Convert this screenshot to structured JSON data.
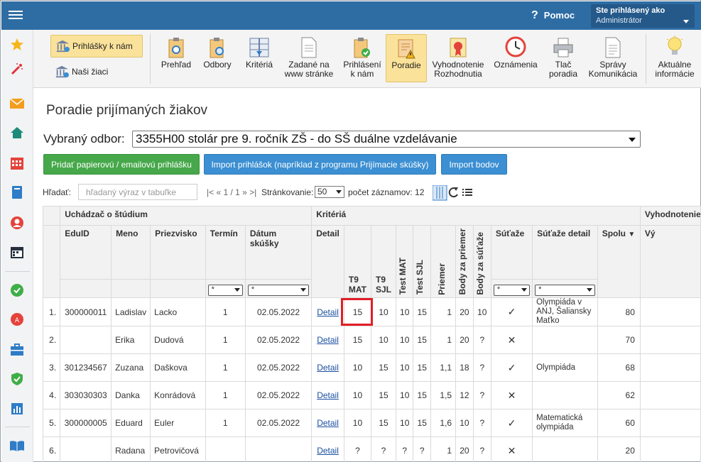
{
  "header": {
    "help_label": "Pomoc",
    "login_title": "Ste prihlásený ako",
    "login_user": "Administrátor"
  },
  "sidebar_icons": [
    "star-icon",
    "magic-wand-icon",
    "envelope-icon",
    "home-icon",
    "calendar-grid-icon",
    "book-icon",
    "person-icon",
    "calendar-icon",
    "check-circle-icon",
    "pdf-icon",
    "briefcase-icon",
    "shield-icon",
    "bar-chart-icon",
    "open-book-icon"
  ],
  "toolbar": {
    "left_buttons": [
      {
        "label": "Prihlášky k nám",
        "active": true
      },
      {
        "label": "Naši žiaci",
        "active": false
      }
    ],
    "buttons": [
      {
        "label": "Prehľad",
        "active": false
      },
      {
        "label": "Odbory",
        "active": false
      },
      {
        "label": "Kritériá",
        "active": false
      },
      {
        "label": "Zadané na\nwww stránke",
        "active": false
      },
      {
        "label": "Prihlásení\nk nám",
        "active": false
      },
      {
        "label": "Poradie",
        "active": true
      },
      {
        "label": "Vyhodnotenie\nRozhodnutia",
        "active": false
      },
      {
        "label": "Oznámenia",
        "active": false
      },
      {
        "label": "Tlač\nporadia",
        "active": false
      },
      {
        "label": "Správy\nKomunikácia",
        "active": false
      },
      {
        "label": "Aktuálne\ninformácie",
        "active": false
      }
    ]
  },
  "page": {
    "title": "Poradie prijímaných žiakov",
    "odbor_label": "Vybraný odbor:",
    "odbor_value": "3355H00 stolár pre 9. ročník ZŠ - do SŠ duálne vzdelávanie",
    "btn_add": "Pridať papierovú / emailovú prihlášku",
    "btn_import": "Import prihlášok (napríklad z programu Prijímacie skúšky)",
    "btn_import_points": "Import bodov",
    "search_label": "Hľadať:",
    "search_placeholder": "hľadaný výraz v tabuľke",
    "pager_text": "|< « 1 / 1 » >|",
    "paging_label": "Stránkovanie:",
    "paging_value": "50",
    "count_label": "počet záznamov: 12"
  },
  "table": {
    "group_headers": {
      "applicant": "Uchádzač o štúdium",
      "criteria": "Kritériá",
      "evaluation": "Vyhodnotenie"
    },
    "headers": {
      "eduid": "EduID",
      "meno": "Meno",
      "priezvisko": "Priezvisko",
      "termin": "Termín",
      "datum": "Dátum skúšky",
      "detail": "Detail",
      "t9mat": "T9\nMAT",
      "t9sjl": "T9\nSJL",
      "testmat": "Test MAT",
      "testsjl": "Test SJL",
      "priemer": "Priemer",
      "body_priemer": "Body za priemer",
      "body_sutaze": "Body za súťaže",
      "sutaze": "Súťaže",
      "sutaze_detail": "Súťaže detail",
      "spolu": "Spolu",
      "vy": "Vý"
    },
    "filter_value": "*",
    "rows": [
      {
        "no": "1.",
        "eduid": "300000011",
        "meno": "Ladislav",
        "priezvisko": "Lacko",
        "termin": "1",
        "datum": "02.05.2022",
        "detail": "Detail",
        "t9mat": "15",
        "t9sjl": "10",
        "testmat": "10",
        "testsjl": "15",
        "priemer": "1",
        "bp": "20",
        "bs": "10",
        "sutaze": "✓",
        "sdetail": "Olympiáda v ANJ, Šaliansky Maťko",
        "spolu": "80"
      },
      {
        "no": "2.",
        "eduid": "",
        "meno": "Erika",
        "priezvisko": "Dudová",
        "termin": "1",
        "datum": "02.05.2022",
        "detail": "Detail",
        "t9mat": "15",
        "t9sjl": "10",
        "testmat": "10",
        "testsjl": "15",
        "priemer": "1",
        "bp": "20",
        "bs": "?",
        "sutaze": "✕",
        "sdetail": "",
        "spolu": "70"
      },
      {
        "no": "3.",
        "eduid": "301234567",
        "meno": "Zuzana",
        "priezvisko": "Daškova",
        "termin": "1",
        "datum": "02.05.2022",
        "detail": "Detail",
        "t9mat": "10",
        "t9sjl": "15",
        "testmat": "10",
        "testsjl": "15",
        "priemer": "1,1",
        "bp": "18",
        "bs": "?",
        "sutaze": "✓",
        "sdetail": "Olympiáda",
        "spolu": "68"
      },
      {
        "no": "4.",
        "eduid": "303030303",
        "meno": "Danka",
        "priezvisko": "Konrádová",
        "termin": "1",
        "datum": "02.05.2022",
        "detail": "Detail",
        "t9mat": "10",
        "t9sjl": "15",
        "testmat": "10",
        "testsjl": "15",
        "priemer": "1,5",
        "bp": "12",
        "bs": "?",
        "sutaze": "✕",
        "sdetail": "",
        "spolu": "62"
      },
      {
        "no": "5.",
        "eduid": "300000005",
        "meno": "Eduard",
        "priezvisko": "Euler",
        "termin": "1",
        "datum": "02.05.2022",
        "detail": "Detail",
        "t9mat": "10",
        "t9sjl": "15",
        "testmat": "10",
        "testsjl": "15",
        "priemer": "1,6",
        "bp": "10",
        "bs": "?",
        "sutaze": "✓",
        "sdetail": "Matematická olympiáda",
        "spolu": "60"
      },
      {
        "no": "6.",
        "eduid": "",
        "meno": "Radana",
        "priezvisko": "Petrovičová",
        "termin": "",
        "datum": "",
        "detail": "Detail",
        "t9mat": "?",
        "t9sjl": "?",
        "testmat": "?",
        "testsjl": "?",
        "priemer": "1",
        "bp": "20",
        "bs": "?",
        "sutaze": "✕",
        "sdetail": "",
        "spolu": "20"
      }
    ]
  }
}
